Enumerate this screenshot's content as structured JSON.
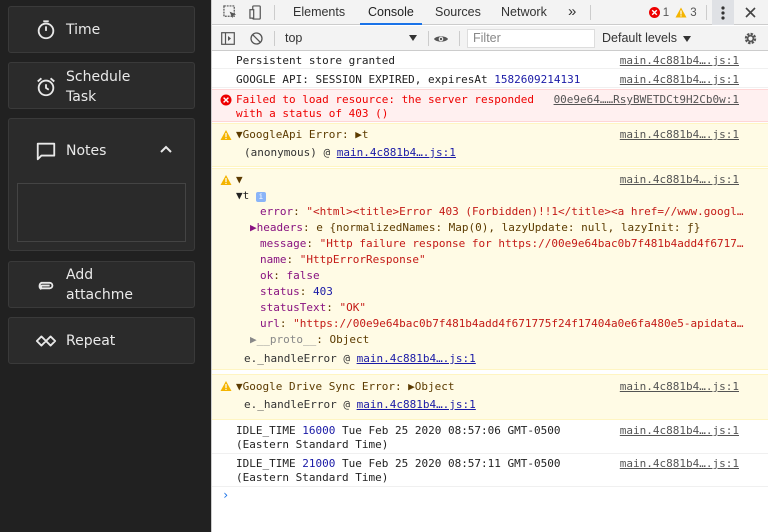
{
  "left_panel": {
    "items": [
      {
        "label": "Time",
        "icon": "timer-icon"
      },
      {
        "label": "Schedule\nTask",
        "icon": "alarm-icon"
      },
      {
        "label": "Notes",
        "icon": "notes-icon"
      },
      {
        "label": "Add\nattachme",
        "icon": "paperclip-icon"
      },
      {
        "label": "Repeat",
        "icon": "repeat-icon"
      }
    ]
  },
  "devtools": {
    "tabs": [
      "Elements",
      "Console",
      "Sources",
      "Network"
    ],
    "active_tab": "Console",
    "more_tabs": "»",
    "error_count": "1",
    "warning_count": "3",
    "context": "top",
    "filter_placeholder": "Filter",
    "levels": "Default levels",
    "colors": {
      "accent": "#1a73e8",
      "error": "#e00000",
      "warning_bg": "#fffbe5",
      "error_bg": "#fff0f0"
    }
  },
  "console": {
    "messages": [
      {
        "type": "log",
        "text": "Persistent store granted",
        "source": "main.4c881b4….js:1"
      },
      {
        "type": "log",
        "text": "GOOGLE API: SESSION EXPIRED, expiresAt ",
        "number": "1582609214131",
        "source": "main.4c881b4….js:1"
      },
      {
        "type": "error",
        "line1": "Failed to load resource: the server responded",
        "line2": "with a status of 403 ()",
        "source": "00e9e64……RsyBWETDCt9H2Cb0w:1"
      },
      {
        "type": "warning",
        "line1": "▼GoogleApi Error: ▶t",
        "line2_prefix": "(anonymous) @ ",
        "line2_link": "main.4c881b4….js:1",
        "source": "main.4c881b4….js:1"
      },
      {
        "type": "warning",
        "header": "▼ ▼",
        "obj_name": "▼t",
        "props": [
          {
            "k": "error",
            "v": "\"<html><title>Error 403 (Forbidden)!!1</title><a href=//www.googl…"
          },
          {
            "k": "▶headers",
            "v": "e {normalizedNames: Map(0), lazyUpdate: null, lazyInit: ƒ}"
          },
          {
            "k": "message",
            "v": "\"Http failure response for https://00e9e64bac0b7f481b4add4f6717…"
          },
          {
            "k": "name",
            "v": "\"HttpErrorResponse\""
          },
          {
            "k": "ok",
            "v": "false"
          },
          {
            "k": "status",
            "v": "403"
          },
          {
            "k": "statusText",
            "v": "\"OK\""
          },
          {
            "k": "url",
            "v": "\"https://00e9e64bac0b7f481b4add4f671775f24f17404a0e6fa480e5-apidata…"
          },
          {
            "k": "▶__proto__",
            "v": "Object"
          }
        ],
        "trace_prefix": "e._handleError @ ",
        "trace_link": "main.4c881b4….js:1",
        "source": "main.4c881b4….js:1"
      },
      {
        "type": "warning",
        "line1": "▼Google Drive Sync Error: ▶Object",
        "line2_prefix": "e._handleError @ ",
        "line2_link": "main.4c881b4….js:1",
        "source": "main.4c881b4….js:1"
      },
      {
        "type": "log",
        "line1_a": "IDLE_TIME ",
        "line1_num": "16000",
        "line1_b": " Tue Feb 25 2020 08:57:06 GMT-0500",
        "line2": "(Eastern Standard Time)",
        "source": "main.4c881b4….js:1"
      },
      {
        "type": "log",
        "line1_a": "IDLE_TIME ",
        "line1_num": "21000",
        "line1_b": " Tue Feb 25 2020 08:57:11 GMT-0500",
        "line2": "(Eastern Standard Time)",
        "source": "main.4c881b4….js:1"
      }
    ],
    "prompt": "›"
  }
}
